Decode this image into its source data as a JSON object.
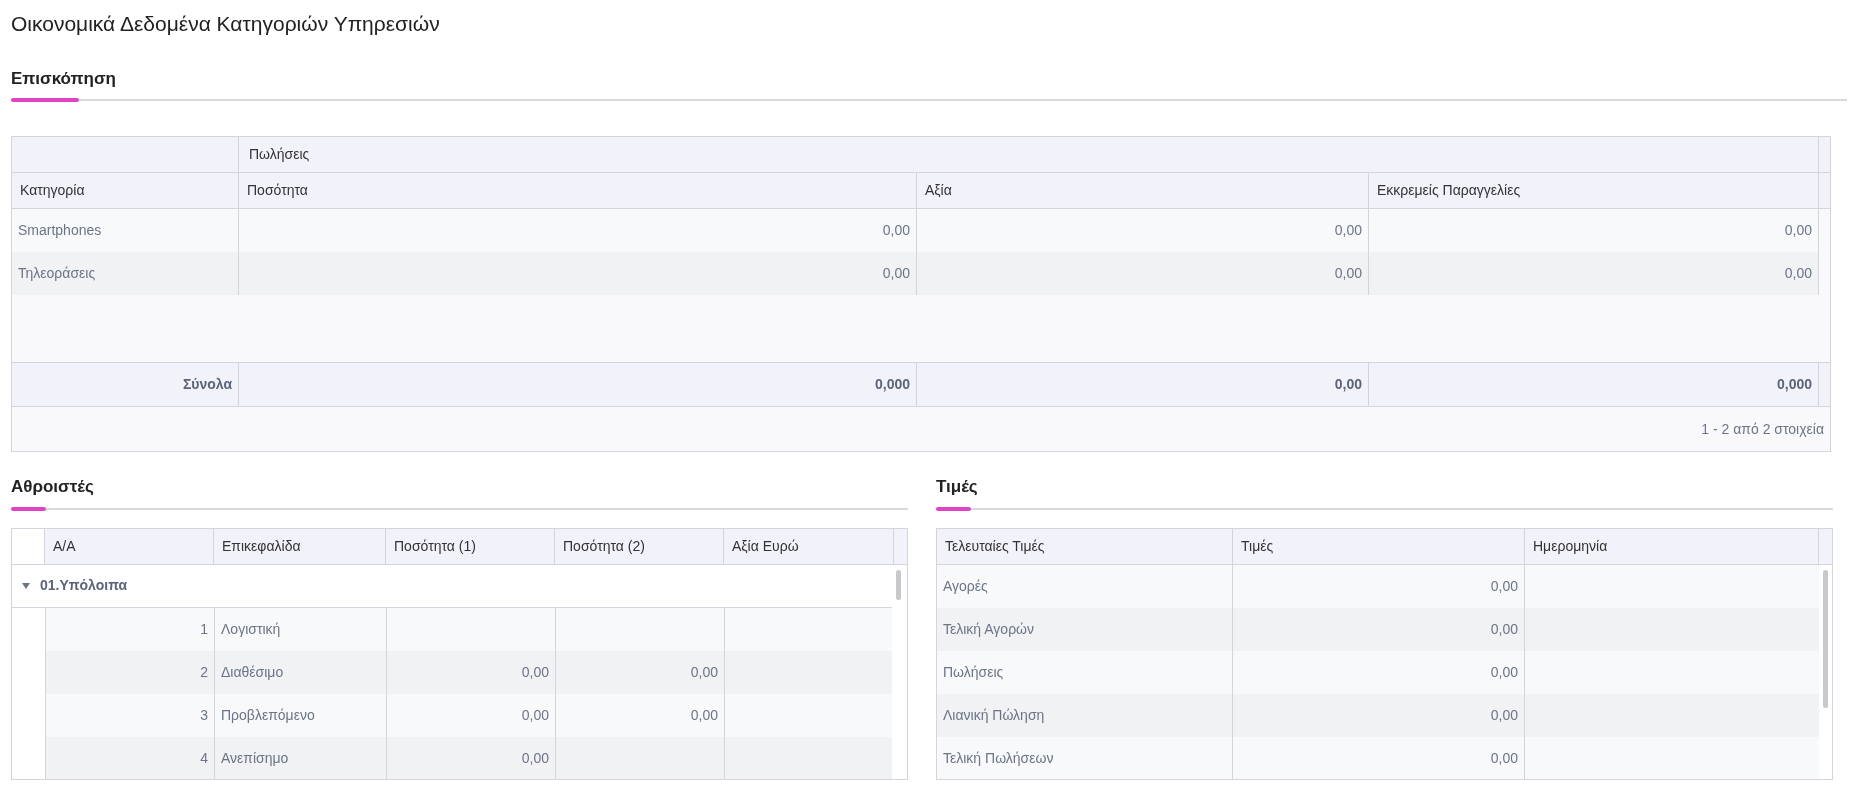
{
  "title": "Οικονομικά Δεδομένα Κατηγοριών Υπηρεσιών",
  "overview": {
    "section_title": "Επισκόπηση",
    "group_header": "Πωλήσεις",
    "columns": [
      "Κατηγορία",
      "Ποσότητα",
      "Αξία",
      "Εκκρεμείς Παραγγελίες"
    ],
    "rows": [
      {
        "category": "Smartphones",
        "values": [
          "0,00",
          "0,00",
          "0,00"
        ]
      },
      {
        "category": "Τηλεοράσεις",
        "values": [
          "0,00",
          "0,00",
          "0,00"
        ]
      }
    ],
    "totals": {
      "label": "Σύνολα",
      "values": [
        "0,000",
        "0,00",
        "0,000"
      ]
    },
    "pager": "1 - 2 από 2 στοιχεία"
  },
  "accumulators": {
    "section_title": "Αθροιστές",
    "columns": [
      "Α/Α",
      "Επικεφαλίδα",
      "Ποσότητα (1)",
      "Ποσότητα (2)",
      "Αξία Ευρώ"
    ],
    "group": {
      "label": "01.Υπόλοιπα",
      "expanded": true,
      "rows": [
        {
          "aa": "1",
          "heading": "Λογιστική"
        },
        {
          "aa": "2",
          "heading": "Διαθέσιμο",
          "q1": "0,00",
          "q2": "0,00"
        },
        {
          "aa": "3",
          "heading": "Προβλεπόμενο",
          "q1": "0,00",
          "q2": "0,00"
        },
        {
          "aa": "4",
          "heading": "Ανεπίσημο",
          "q1": "0,00"
        }
      ]
    }
  },
  "prices": {
    "section_title": "Τιμές",
    "columns": [
      "Τελευταίες Τιμές",
      "Τιμές",
      "Ημερομηνία"
    ],
    "rows": [
      {
        "label": "Αγορές",
        "price": "0,00"
      },
      {
        "label": "Τελική Αγορών",
        "price": "0,00"
      },
      {
        "label": "Πωλήσεις",
        "price": "0,00"
      },
      {
        "label": "Λιανική Πώληση",
        "price": "0,00"
      },
      {
        "label": "Τελική Πωλήσεων",
        "price": "0,00"
      }
    ]
  }
}
